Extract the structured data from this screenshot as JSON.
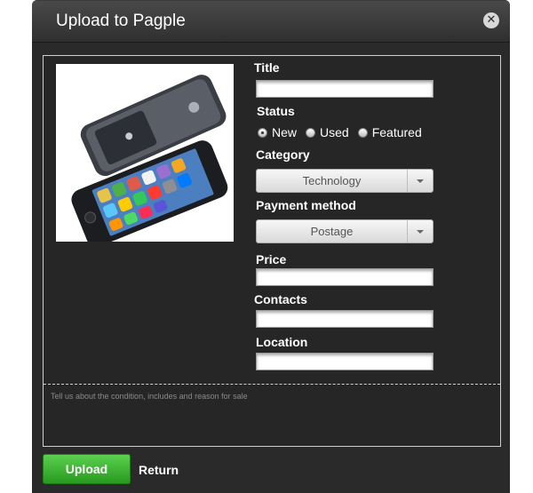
{
  "dialog": {
    "title": "Upload to Pagple"
  },
  "photo": {
    "description": "iPhone 5 product photo"
  },
  "form": {
    "title_label": "Title",
    "title_value": "",
    "status_label": "Status",
    "status_options": [
      "New",
      "Used",
      "Featured"
    ],
    "status_selected": "New",
    "category_label": "Category",
    "category_value": "Technology",
    "payment_label": "Payment method",
    "payment_value": "Postage",
    "price_label": "Price",
    "price_value": "",
    "contacts_label": "Contacts",
    "contacts_value": "",
    "location_label": "Location",
    "location_value": ""
  },
  "description": {
    "placeholder": "Tell us about the condition, includes and reason for sale"
  },
  "actions": {
    "upload_label": "Upload",
    "return_label": "Return"
  },
  "colors": {
    "dialog_bg": "#2a2a2a",
    "upload_green": "#3bb530",
    "panel_border": "#cfcfcf"
  }
}
